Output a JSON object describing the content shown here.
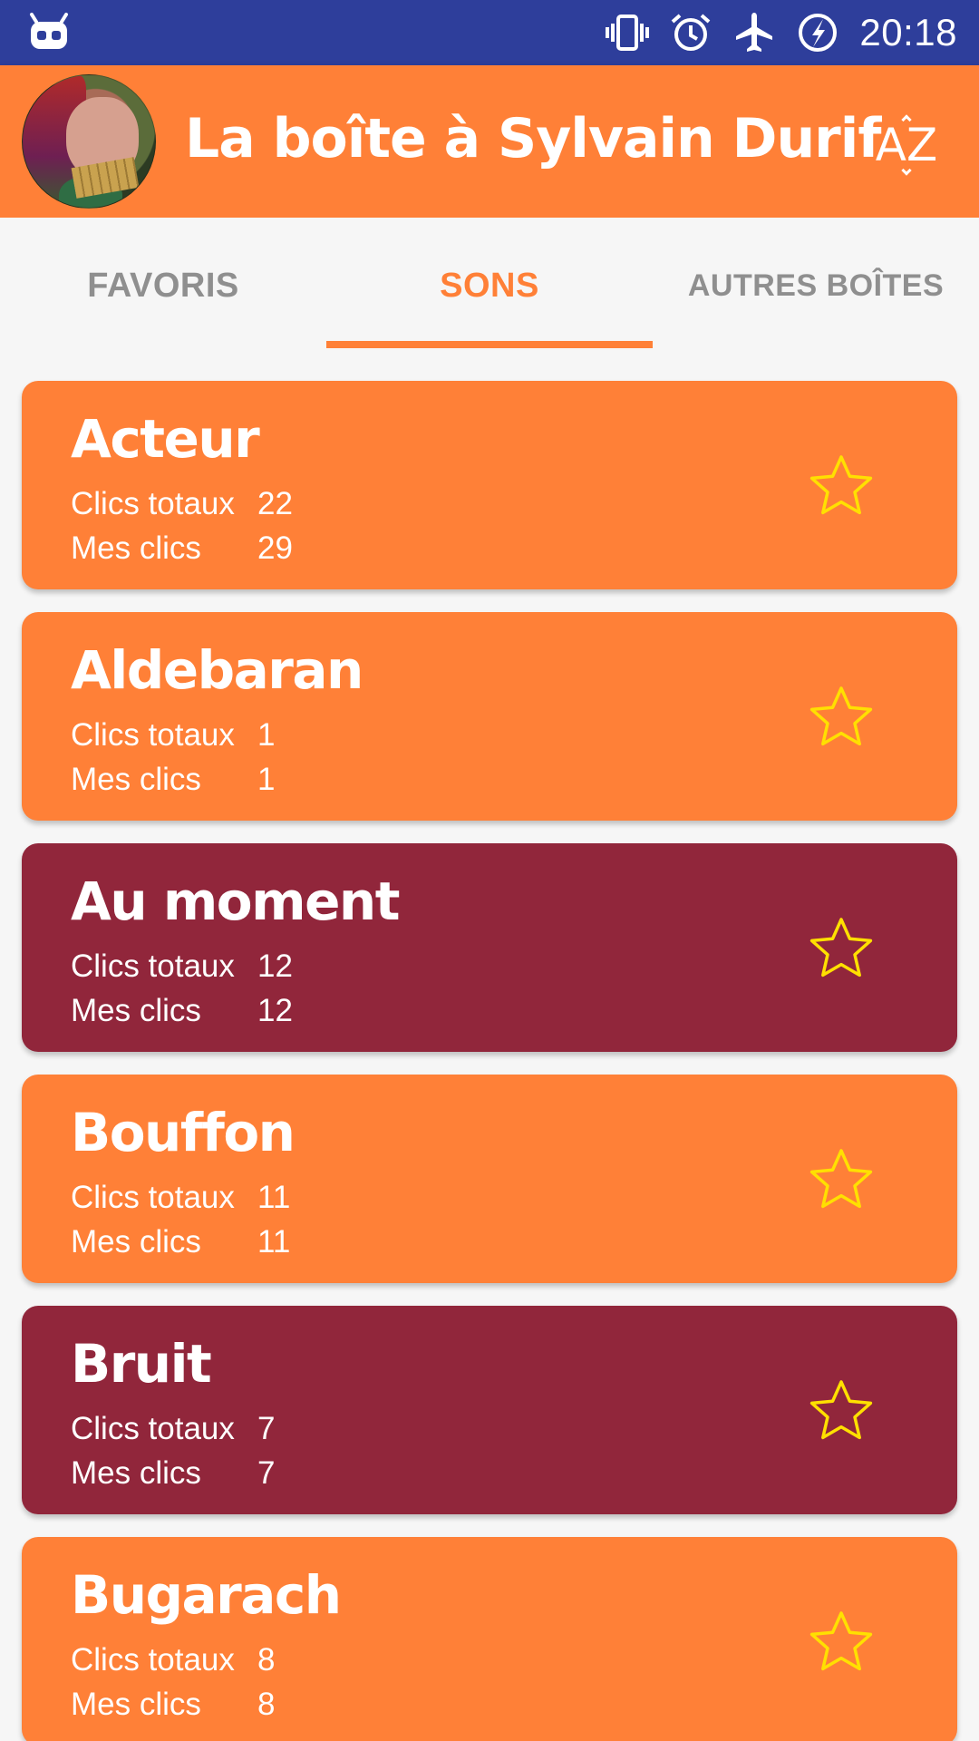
{
  "status_bar": {
    "time": "20:18",
    "icons": [
      "android-debug-icon",
      "vibrate-icon",
      "alarm-icon",
      "airplane-mode-icon",
      "battery-charging-icon"
    ]
  },
  "app_bar": {
    "title": "La boîte à Sylvain Durif",
    "sort_label": "AZ",
    "color": "#ff8037"
  },
  "tabs": [
    {
      "label": "FAVORIS",
      "active": false
    },
    {
      "label": "SONS",
      "active": true
    },
    {
      "label": "AUTRES BOÎTES",
      "active": false
    }
  ],
  "colors": {
    "orange": "#ff8037",
    "crimson": "#91263b",
    "star": "#ffe000",
    "status_bar": "#2e3e9b"
  },
  "stat_labels": {
    "total": "Clics totaux",
    "mine": "Mes clics"
  },
  "sounds": [
    {
      "name": "Acteur",
      "total": "22",
      "mine": "29",
      "color": "#ff8037",
      "favorite": false
    },
    {
      "name": "Aldebaran",
      "total": "1",
      "mine": "1",
      "color": "#ff8037",
      "favorite": false
    },
    {
      "name": "Au moment",
      "total": "12",
      "mine": "12",
      "color": "#91263b",
      "favorite": false
    },
    {
      "name": "Bouffon",
      "total": "11",
      "mine": "11",
      "color": "#ff8037",
      "favorite": false
    },
    {
      "name": "Bruit",
      "total": "7",
      "mine": "7",
      "color": "#91263b",
      "favorite": false
    },
    {
      "name": "Bugarach",
      "total": "8",
      "mine": "8",
      "color": "#ff8037",
      "favorite": false
    }
  ]
}
